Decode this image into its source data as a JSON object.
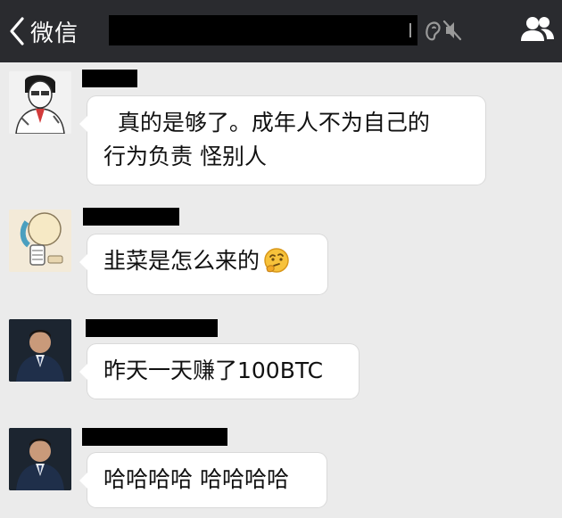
{
  "nav": {
    "back_label": "微信",
    "title": "",
    "muted": true
  },
  "messages": [
    {
      "sender": "",
      "text": "  真的是够了。成年人不为自己的\n行为负责 怪别人",
      "avatar": "sketch-person-avatar"
    },
    {
      "sender": "",
      "text": "韭菜是怎么来的",
      "emoji": "thinking-face-emoji",
      "avatar": "cartoon-skeleton-avatar"
    },
    {
      "sender": "",
      "text": "昨天一天赚了100BTC",
      "avatar": "man-in-suit-avatar"
    },
    {
      "sender": "",
      "text": "哈哈哈哈 哈哈哈哈",
      "avatar": "man-in-suit-avatar"
    }
  ],
  "colors": {
    "navbar": "#2a2b2f",
    "chat_background": "#ebebeb",
    "bubble": "#ffffff"
  }
}
